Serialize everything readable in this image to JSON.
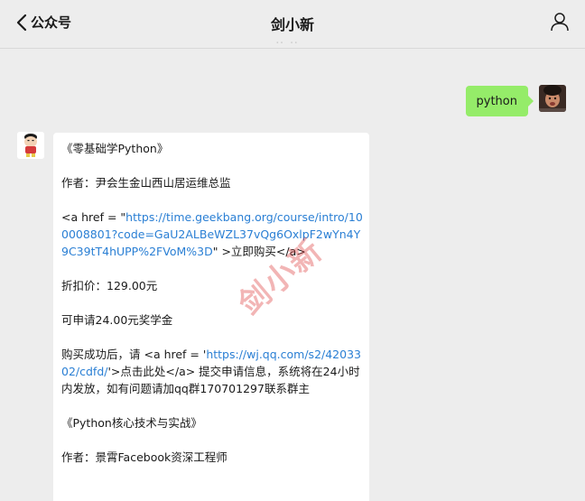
{
  "nav": {
    "back_label": "公众号",
    "title": "剑小新"
  },
  "messages": {
    "sent": "python",
    "received": {
      "line1": "《零基础学Python》",
      "line2": "作者：尹会生金山西山居运维总监",
      "line3_pre": "<a href = \"",
      "line3_link": "https://time.geekbang.org/course/intro/100008801?code=GaU2ALBeWZL37vQg6OxlpF2wYn4Y9C39tT4hUPP%2FVoM%3D",
      "line3_post": "\" >立即购买</a>",
      "line4": "折扣价：129.00元",
      "line5": "可申请24.00元奖学金",
      "line6_pre": "购买成功后，请 <a href = '",
      "line6_link": "https://wj.qq.com/s2/4203302/cdfd/",
      "line6_post": "'>点击此处</a> 提交申请信息，系统将在24小时内发放，如有问题请加qq群170701297联系群主",
      "line7": "《Python核心技术与实战》",
      "line8": "作者：景霄Facebook资深工程师"
    }
  },
  "watermark": "剑小新",
  "colors": {
    "background": "#ededed",
    "sent_bubble": "#95ec69",
    "link": "#2a7fd4"
  }
}
